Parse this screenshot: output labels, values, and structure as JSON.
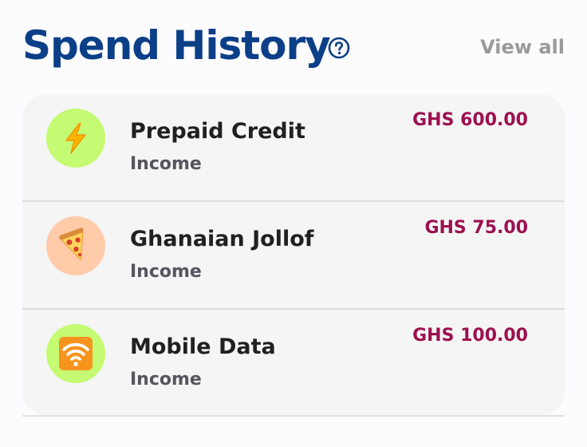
{
  "header": {
    "title": "Spend History",
    "help_icon": "question-circle-icon",
    "view_all_label": "View all"
  },
  "colors": {
    "title": "#0b3f87",
    "amount": "#9c1050",
    "green_avatar": "#c5fa73",
    "peach_avatar": "#ffcba8",
    "card": "#f4f5f4"
  },
  "transactions": [
    {
      "name": "Prepaid Credit",
      "type": "Income",
      "amount": "GHS 600.00",
      "icon": "lightning-icon",
      "avatar_color": "#c5fa73"
    },
    {
      "name": "Ghanaian Jollof",
      "type": "Income",
      "amount": "GHS 75.00",
      "icon": "pizza-icon",
      "avatar_color": "#ffcba8"
    },
    {
      "name": "Mobile Data",
      "type": "Income",
      "amount": "GHS 100.00",
      "icon": "wifi-icon",
      "avatar_color": "#c5fa73"
    }
  ]
}
